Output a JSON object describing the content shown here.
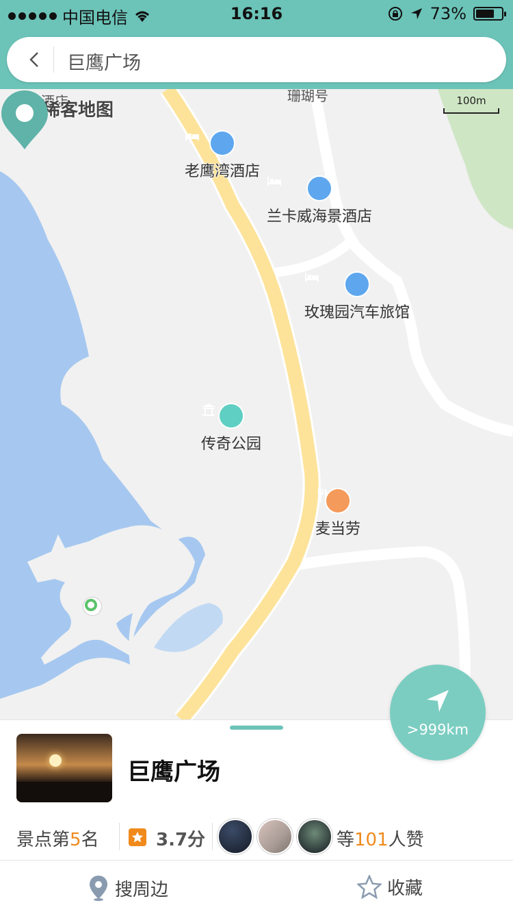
{
  "status_bar": {
    "carrier": "中国电信",
    "time": "16:16",
    "battery_percent": "73%",
    "battery_level": 0.73
  },
  "header": {
    "search_text": "巨鹰广场"
  },
  "map": {
    "brand": "稀客地图",
    "scale_label": "100m",
    "cut_labels": [
      "酒店",
      "珊瑚号"
    ],
    "pois": [
      {
        "id": "laoyingwan",
        "label": "老鹰湾酒店",
        "icon": "hotel-icon",
        "color": "#5ea7ee"
      },
      {
        "id": "lankawei",
        "label": "兰卡威海景酒店",
        "icon": "hotel-icon",
        "color": "#5ea7ee"
      },
      {
        "id": "meigui",
        "label": "玫瑰园汽车旅馆",
        "icon": "hotel-icon",
        "color": "#5ea7ee"
      },
      {
        "id": "chuanqi",
        "label": "传奇公园",
        "icon": "park-icon",
        "color": "#5fcfc3"
      },
      {
        "id": "mcdonalds",
        "label": "麦当劳",
        "icon": "restaurant-icon",
        "color": "#f49a5a"
      }
    ],
    "water_color": "#a6c8f0",
    "road_main_color": "#fde39a",
    "green_color": "#cfe6c5"
  },
  "navigate": {
    "distance": ">999km"
  },
  "place": {
    "title": "巨鹰广场",
    "rank_prefix": "景点第",
    "rank_number": "5",
    "rank_suffix": "名",
    "score": "3.7分",
    "likes_prefix": "等",
    "likes_count": "101",
    "likes_suffix": "人赞"
  },
  "actions": {
    "nearby": "搜周边",
    "favorite": "收藏"
  },
  "colors": {
    "accent": "#6cc3b8",
    "highlight": "#f08a1c"
  }
}
